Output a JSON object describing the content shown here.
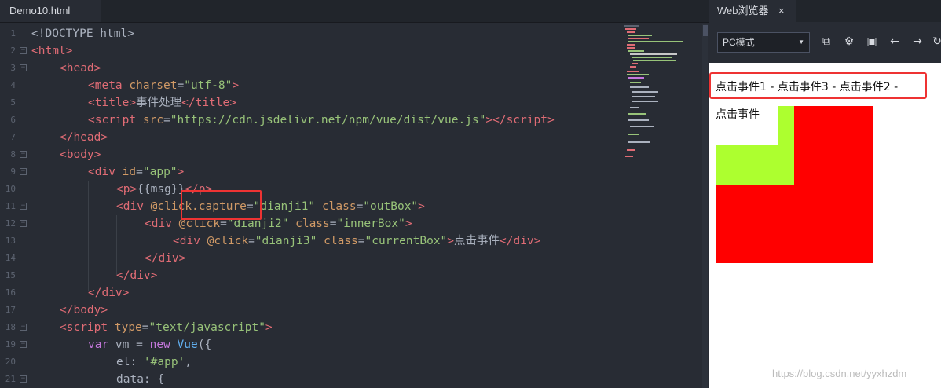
{
  "editor": {
    "tab_title": "Demo10.html",
    "line_numbers": [
      "1",
      "2",
      "3",
      "4",
      "5",
      "6",
      "7",
      "8",
      "9",
      "10",
      "11",
      "12",
      "13",
      "14",
      "15",
      "16",
      "17",
      "18",
      "19",
      "20",
      "21"
    ]
  },
  "code": {
    "l1": "<!DOCTYPE html>",
    "l2_open": "<",
    "l2_tag": "html",
    "l2_close": ">",
    "l3_tag": "head",
    "l4_tag": "meta",
    "l4_attr": "charset",
    "l4_val": "\"utf-8\"",
    "l5_tag": "title",
    "l5_text": "事件处理",
    "l6_tag": "script",
    "l6_attr": "src",
    "l6_val": "\"https://cdn.jsdelivr.net/npm/vue/dist/vue.js\"",
    "l7_tag": "/head",
    "l8_tag": "body",
    "l9_tag": "div",
    "l9_attr": "id",
    "l9_val": "\"app\"",
    "l10_p": "p",
    "l10_text": "{{msg}}",
    "l10_pclose": "/p",
    "l11_attr": "@click.capture",
    "l11_val": "\"dianji1\"",
    "l11_class": "class",
    "l11_classval": "\"outBox\"",
    "l12_attr": "@click",
    "l12_val": "\"dianji2\"",
    "l12_classval": "\"innerBox\"",
    "l13_val": "\"dianji3\"",
    "l13_classval": "\"currentBox\"",
    "l13_text": "点击事件",
    "l14_tag": "/div",
    "l17_tag": "/body",
    "l18_tag": "script",
    "l18_attr": "type",
    "l18_val": "\"text/javascript\"",
    "l19_var": "var",
    "l19_name": " vm = ",
    "l19_new": "new",
    "l19_vue": " Vue",
    "l19_rest": "({",
    "l20_key": "el: ",
    "l20_val": "'#app'",
    "l20_comma": ",",
    "l21_key": "data: {"
  },
  "browser": {
    "tab_title": "Web浏览器",
    "tab_close": "×",
    "mode_value": "PC模式",
    "message": "点击事件1 - 点击事件3 - 点击事件2 -",
    "box_text": "点击事件",
    "watermark": "https://blog.csdn.net/yyxhzdm"
  },
  "colors": {
    "outer_box": "#ff0000",
    "inner_box": "#adff2f",
    "highlight": "#e33333"
  }
}
